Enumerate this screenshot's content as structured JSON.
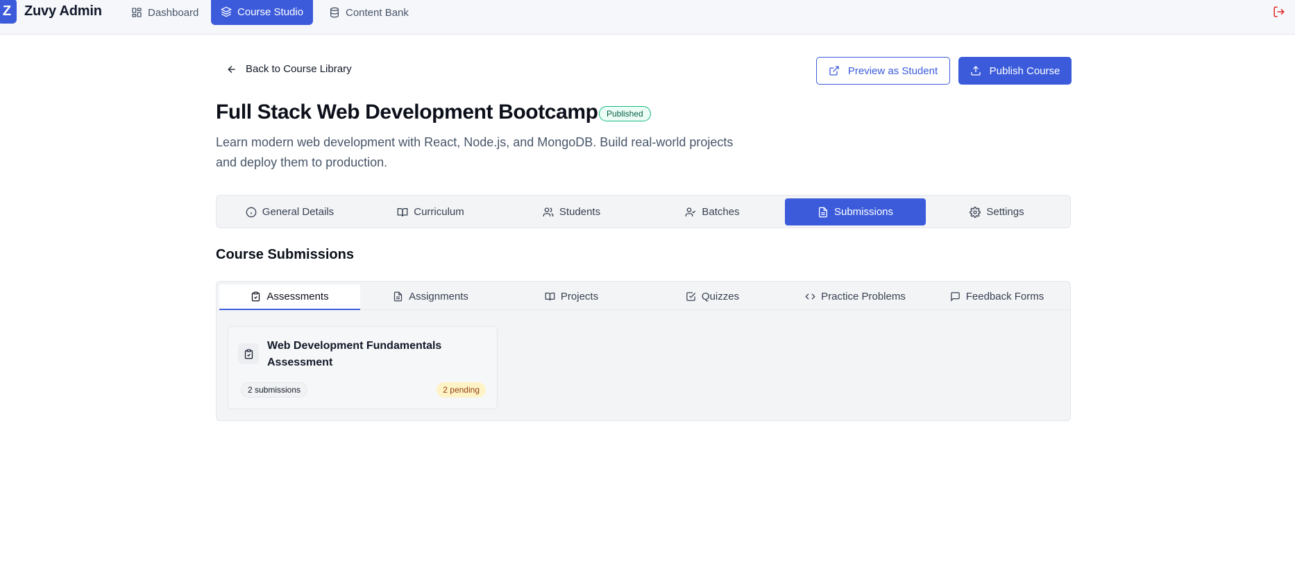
{
  "app": {
    "logo_letter": "Z",
    "brand": "Zuvy Admin"
  },
  "nav": {
    "dashboard": "Dashboard",
    "course_studio": "Course Studio",
    "content_bank": "Content Bank"
  },
  "header": {
    "back_label": "Back to Course Library",
    "preview_label": "Preview as Student",
    "publish_label": "Publish Course"
  },
  "course": {
    "title": "Full Stack Web Development Bootcamp",
    "status": "Published",
    "description": "Learn modern web development with React, Node.js, and MongoDB. Build real-world projects and deploy them to production."
  },
  "tabs": [
    {
      "label": "General Details",
      "icon": "info-icon"
    },
    {
      "label": "Curriculum",
      "icon": "book-icon"
    },
    {
      "label": "Students",
      "icon": "users-icon"
    },
    {
      "label": "Batches",
      "icon": "user-check-icon"
    },
    {
      "label": "Submissions",
      "icon": "file-text-icon",
      "active": true
    },
    {
      "label": "Settings",
      "icon": "gear-icon"
    }
  ],
  "section_title": "Course Submissions",
  "subtabs": [
    {
      "label": "Assessments",
      "icon": "clipboard-check-icon",
      "active": true
    },
    {
      "label": "Assignments",
      "icon": "file-text-icon"
    },
    {
      "label": "Projects",
      "icon": "book-icon"
    },
    {
      "label": "Quizzes",
      "icon": "check-square-icon"
    },
    {
      "label": "Practice Problems",
      "icon": "code-icon"
    },
    {
      "label": "Feedback Forms",
      "icon": "message-icon"
    }
  ],
  "cards": [
    {
      "title": "Web Development Fundamentals Assessment",
      "submissions": "2 submissions",
      "pending": "2 pending"
    }
  ],
  "colors": {
    "accent": "#3b5bdb",
    "published": "#10b981",
    "pending_bg": "#fef3c7",
    "logout": "#dc2626"
  }
}
